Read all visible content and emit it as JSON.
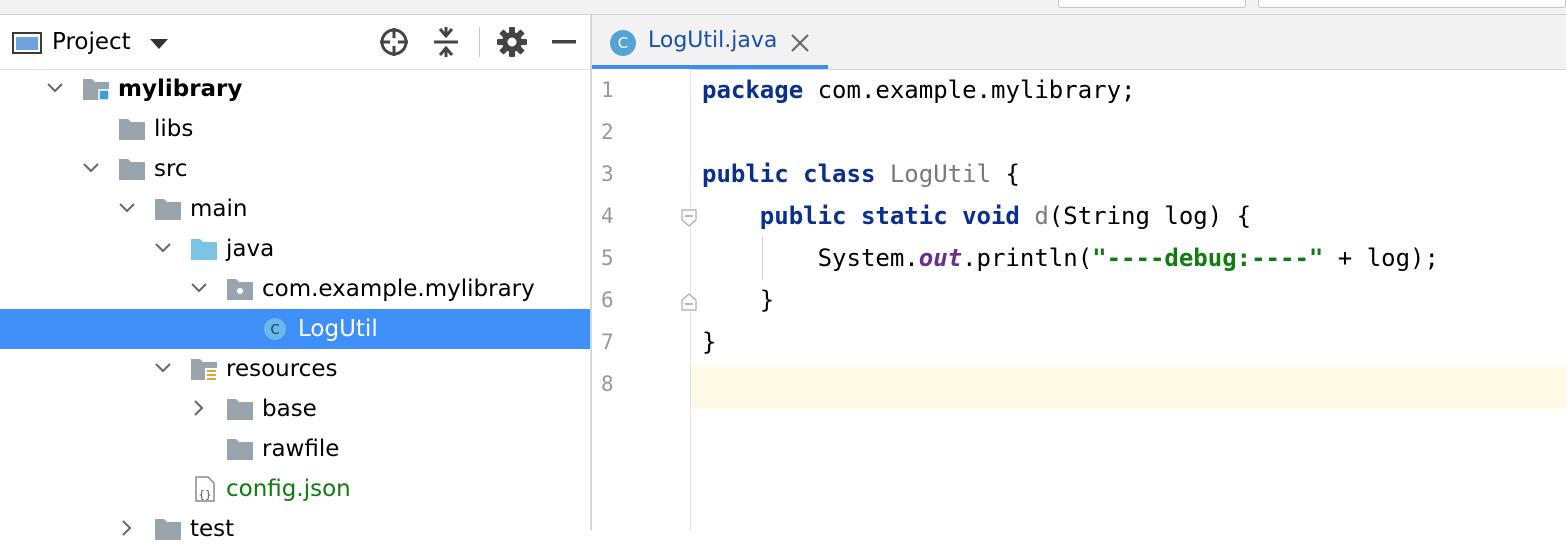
{
  "project_panel": {
    "title": "Project",
    "tree": [
      {
        "label": "mylibrary",
        "chevron": "down",
        "icon": "module-folder-icon",
        "bold": true
      },
      {
        "label": "libs",
        "chevron": "none",
        "icon": "folder-icon"
      },
      {
        "label": "src",
        "chevron": "down",
        "icon": "folder-icon"
      },
      {
        "label": "main",
        "chevron": "down",
        "icon": "folder-icon"
      },
      {
        "label": "java",
        "chevron": "down",
        "icon": "source-folder-icon"
      },
      {
        "label": "com.example.mylibrary",
        "chevron": "down",
        "icon": "package-icon"
      },
      {
        "label": "LogUtil",
        "chevron": "none",
        "icon": "class-icon",
        "selected": true
      },
      {
        "label": "resources",
        "chevron": "down",
        "icon": "resources-folder-icon"
      },
      {
        "label": "base",
        "chevron": "right",
        "icon": "folder-icon"
      },
      {
        "label": "rawfile",
        "chevron": "none",
        "icon": "folder-icon"
      },
      {
        "label": "config.json",
        "chevron": "none",
        "icon": "json-file-icon",
        "color": "#107c10"
      },
      {
        "label": "test",
        "chevron": "right",
        "icon": "folder-icon"
      }
    ]
  },
  "editor": {
    "tab": {
      "label": "LogUtil.java",
      "icon_letter": "C"
    },
    "line_numbers": [
      "1",
      "2",
      "3",
      "4",
      "5",
      "6",
      "7",
      "8"
    ],
    "code": {
      "l1_kw": "package",
      "l1_rest": " com.example.mylibrary;",
      "l3_kw": "public class",
      "l3_name": " LogUtil",
      "l3_rest": " {",
      "l4_indent": "    ",
      "l4_kw": "public static void",
      "l4_name": " d",
      "l4_rest": "(String log) {",
      "l5_a": "        System.",
      "l5_field": "out",
      "l5_b": ".println(",
      "l5_str": "\"----debug:----\"",
      "l5_c": " + log);",
      "l6": "    }",
      "l7": "}"
    }
  },
  "colors": {
    "selection": "#3f8ff9",
    "keyword": "#0a2f8c",
    "string": "#107c10",
    "current_line": "#fffae6"
  }
}
